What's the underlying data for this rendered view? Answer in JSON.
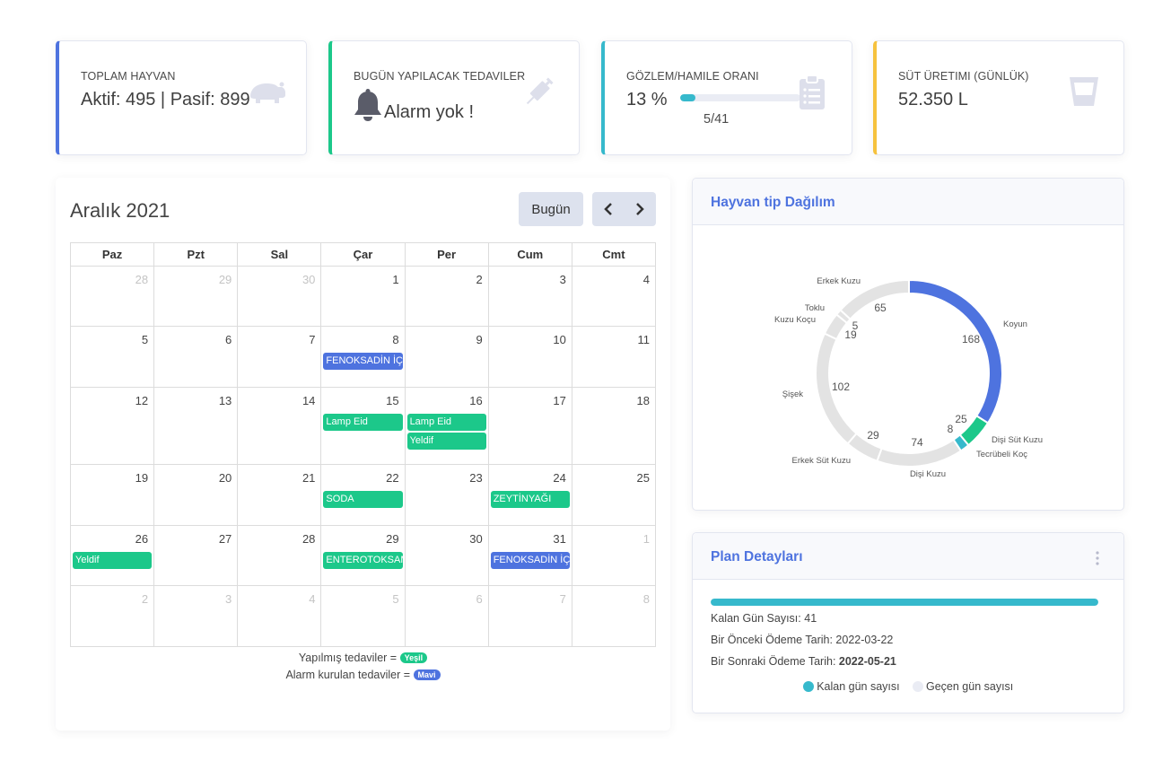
{
  "stats": [
    {
      "label": "TOPLAM HAYVAN",
      "value": "Aktif: 495 | Pasif: 899",
      "icon": "hippo-icon"
    },
    {
      "label": "BUGÜN YAPILACAK TEDAVILER",
      "value": "Alarm yok !",
      "icon": "syringe-icon"
    },
    {
      "label": "GÖZLEM/HAMILE ORANI",
      "value": "13 %",
      "progress": 0.13,
      "count": "5/41",
      "icon": "clipboard-icon"
    },
    {
      "label": "SÜT ÜRETIMI (GÜNLÜK)",
      "value": "52.350 L",
      "icon": "glass-icon"
    }
  ],
  "calendar": {
    "title": "Aralık 2021",
    "today_label": "Bugün",
    "weekdays": [
      "Paz",
      "Pzt",
      "Sal",
      "Çar",
      "Per",
      "Cum",
      "Cmt"
    ],
    "weeks": [
      [
        {
          "d": "28",
          "o": true
        },
        {
          "d": "29",
          "o": true
        },
        {
          "d": "30",
          "o": true
        },
        {
          "d": "1"
        },
        {
          "d": "2"
        },
        {
          "d": "3"
        },
        {
          "d": "4"
        }
      ],
      [
        {
          "d": "5"
        },
        {
          "d": "6"
        },
        {
          "d": "7"
        },
        {
          "d": "8"
        },
        {
          "d": "9"
        },
        {
          "d": "10"
        },
        {
          "d": "11"
        }
      ],
      [
        {
          "d": "12"
        },
        {
          "d": "13"
        },
        {
          "d": "14"
        },
        {
          "d": "15"
        },
        {
          "d": "16"
        },
        {
          "d": "17"
        },
        {
          "d": "18"
        }
      ],
      [
        {
          "d": "19"
        },
        {
          "d": "20"
        },
        {
          "d": "21"
        },
        {
          "d": "22"
        },
        {
          "d": "23"
        },
        {
          "d": "24"
        },
        {
          "d": "25"
        }
      ],
      [
        {
          "d": "26"
        },
        {
          "d": "27"
        },
        {
          "d": "28"
        },
        {
          "d": "29"
        },
        {
          "d": "30"
        },
        {
          "d": "31"
        },
        {
          "d": "1",
          "o": true
        }
      ],
      [
        {
          "d": "2",
          "o": true
        },
        {
          "d": "3",
          "o": true
        },
        {
          "d": "4",
          "o": true
        },
        {
          "d": "5",
          "o": true
        },
        {
          "d": "6",
          "o": true
        },
        {
          "d": "7",
          "o": true
        },
        {
          "d": "8",
          "o": true
        }
      ]
    ],
    "events": [
      {
        "week": 1,
        "day": 3,
        "slot": 0,
        "label": "FENOKSADİN İÇ P",
        "color": "blue"
      },
      {
        "week": 2,
        "day": 3,
        "slot": 0,
        "label": "Lamp Eid",
        "color": "green"
      },
      {
        "week": 2,
        "day": 4,
        "slot": 0,
        "label": "Lamp Eid",
        "color": "green"
      },
      {
        "week": 2,
        "day": 4,
        "slot": 1,
        "label": "Yeldif",
        "color": "green"
      },
      {
        "week": 3,
        "day": 3,
        "slot": 0,
        "label": "SODA",
        "color": "green"
      },
      {
        "week": 3,
        "day": 5,
        "slot": 0,
        "label": "ZEYTİNYAĞI",
        "color": "green"
      },
      {
        "week": 4,
        "day": 0,
        "slot": 0,
        "label": "Yeldif",
        "color": "green"
      },
      {
        "week": 4,
        "day": 3,
        "slot": 0,
        "label": "ENTEROTOKSAMI",
        "color": "green"
      },
      {
        "week": 4,
        "day": 5,
        "slot": 0,
        "label": "FENOKSADİN İÇ P",
        "color": "blue"
      }
    ],
    "legend": [
      {
        "text": "Yapılmış tedaviler =",
        "badge": "Yeşil",
        "color": "#1cc88a"
      },
      {
        "text": "Alarm kurulan tedaviler =",
        "badge": "Mavi",
        "color": "#4e73df"
      }
    ]
  },
  "chart_card": {
    "title": "Hayvan tip Dağılım"
  },
  "chart_data": {
    "type": "pie",
    "title": "Hayvan tip Dağılım",
    "series": [
      {
        "label": "Koyun",
        "value": 168,
        "color": "#4e73df"
      },
      {
        "label": "Dişi Süt Kuzu",
        "value": 25,
        "color": "#1cc88a"
      },
      {
        "label": "Tecrübeli Koç",
        "value": 8,
        "color": "#36b9cc"
      },
      {
        "label": "Dişi Kuzu",
        "value": 74,
        "color": "#e3e3e3"
      },
      {
        "label": "Erkek Süt Kuzu",
        "value": 29,
        "color": "#e3e3e3"
      },
      {
        "label": "Şişek",
        "value": 102,
        "color": "#e3e3e3"
      },
      {
        "label": "Kuzu Koçu",
        "value": 19,
        "color": "#e3e3e3"
      },
      {
        "label": "Toklu",
        "value": 5,
        "color": "#e3e3e3"
      },
      {
        "label": "Erkek Kuzu",
        "value": 65,
        "color": "#e3e3e3"
      }
    ]
  },
  "plan": {
    "title": "Plan Detayları",
    "progress": 1.0,
    "remaining_label": "Kalan Gün Sayısı:",
    "remaining_value": "41",
    "prev_label": "Bir Önceki Ödeme Tarih:",
    "prev_value": "2022-03-22",
    "next_label": "Bir Sonraki Ödeme Tarih:",
    "next_value": "2022-05-21",
    "legend_remaining": "Kalan gün sayısı",
    "legend_passed": "Geçen gün sayısı",
    "color_remaining": "#36b9cc",
    "color_passed": "#eaecf4"
  }
}
